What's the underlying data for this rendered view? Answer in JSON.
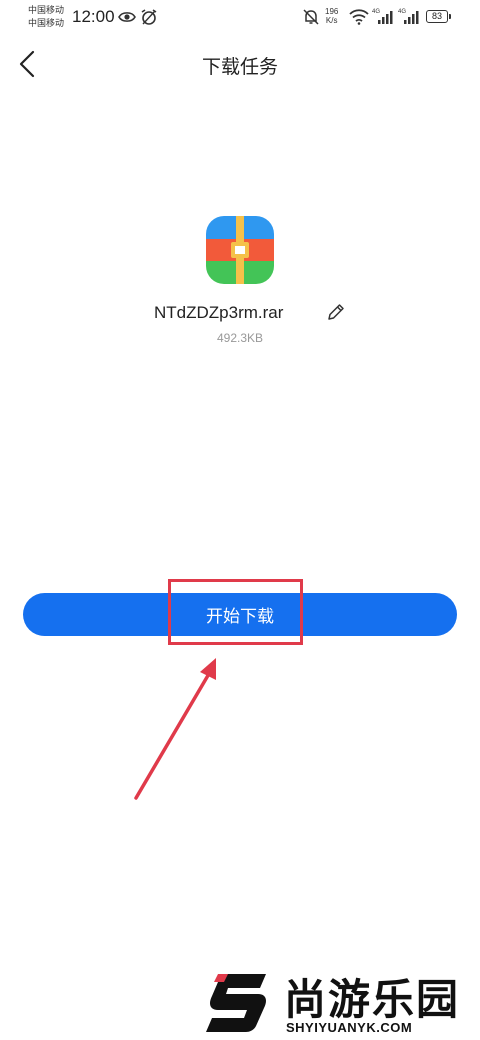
{
  "status_bar": {
    "carrier_1": "中国移动",
    "carrier_2": "中国移动",
    "time": "12:00",
    "speed_value": "196",
    "speed_unit": "K/s",
    "network_1": "4G",
    "network_2": "4G",
    "battery": "83"
  },
  "header": {
    "title": "下载任务",
    "back_icon": "chevron-left-icon"
  },
  "file": {
    "name": "NTdZDZp3rm.rar",
    "size": "492.3KB",
    "icon": "archive-icon",
    "edit_icon": "pencil-icon"
  },
  "actions": {
    "download_label": "开始下载"
  },
  "annotation": {
    "highlight_color": "#e03a4a"
  },
  "watermark": {
    "title": "尚游乐园",
    "subtitle": "SHYIYUANYK.COM"
  },
  "colors": {
    "accent": "#1570ef"
  }
}
